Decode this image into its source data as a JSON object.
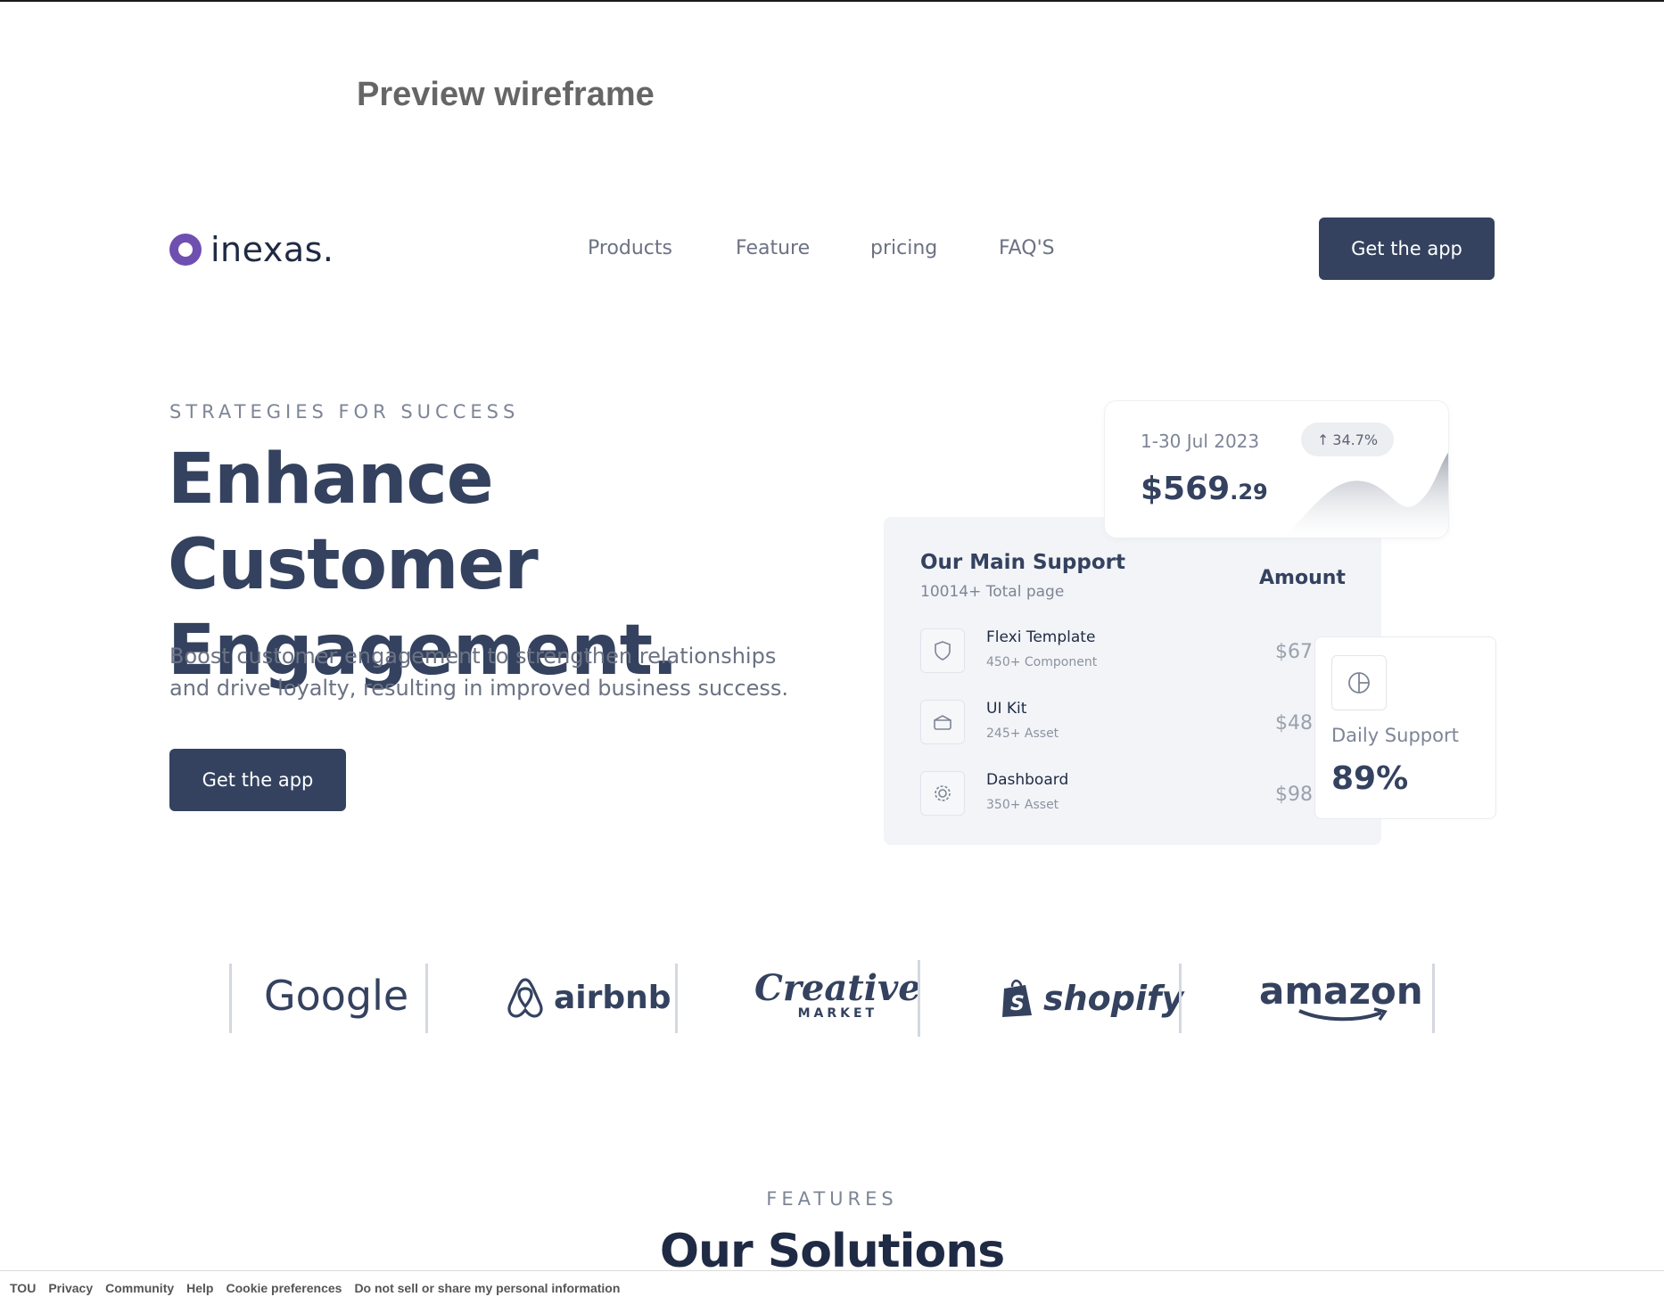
{
  "preview_title": "Preview wireframe",
  "brand": {
    "name": "inexas.",
    "color": "#6f4fb0"
  },
  "nav": {
    "links": [
      "Products",
      "Feature",
      "pricing",
      "FAQ'S"
    ],
    "cta": "Get the app"
  },
  "hero": {
    "eyebrow": "STRATEGIES FOR SUCCESS",
    "title_line1": "Enhance Customer",
    "title_line2": "Engagement.",
    "description": "Boost customer engagement to strengthen relationships and drive loyalty, resulting in improved business success.",
    "cta": "Get the app"
  },
  "revenue_card": {
    "date_range": "1-30 Jul 2023",
    "change": "34.7%",
    "amount_main": "$569",
    "amount_cents": ".29"
  },
  "support_card": {
    "title": "Our Main Support",
    "subtitle": "10014+ Total page",
    "amount_header": "Amount",
    "rows": [
      {
        "name": "Flexi Template",
        "meta": "450+ Component",
        "value": "$67",
        "icon": "shield-icon"
      },
      {
        "name": "UI Kit",
        "meta": "245+ Asset",
        "value": "$48",
        "icon": "box-icon"
      },
      {
        "name": "Dashboard",
        "meta": "350+ Asset",
        "value": "$98",
        "icon": "gear-icon"
      }
    ]
  },
  "daily_card": {
    "label": "Daily Support",
    "value": "89%",
    "icon": "pie-chart-icon"
  },
  "logos": {
    "google": "Google",
    "airbnb": "airbnb",
    "creative": "Creative",
    "creative_sub": "MARKET",
    "shopify": "shopify",
    "amazon": "amazon"
  },
  "features": {
    "eyebrow": "FEATURES",
    "title": "Our Solutions"
  },
  "footer": {
    "links": [
      "TOU",
      "Privacy",
      "Community",
      "Help",
      "Cookie preferences",
      "Do not sell or share my personal information"
    ]
  },
  "colors": {
    "primary": "#34425f",
    "text_muted": "#6b7283",
    "card_bg": "#f2f4f7"
  }
}
